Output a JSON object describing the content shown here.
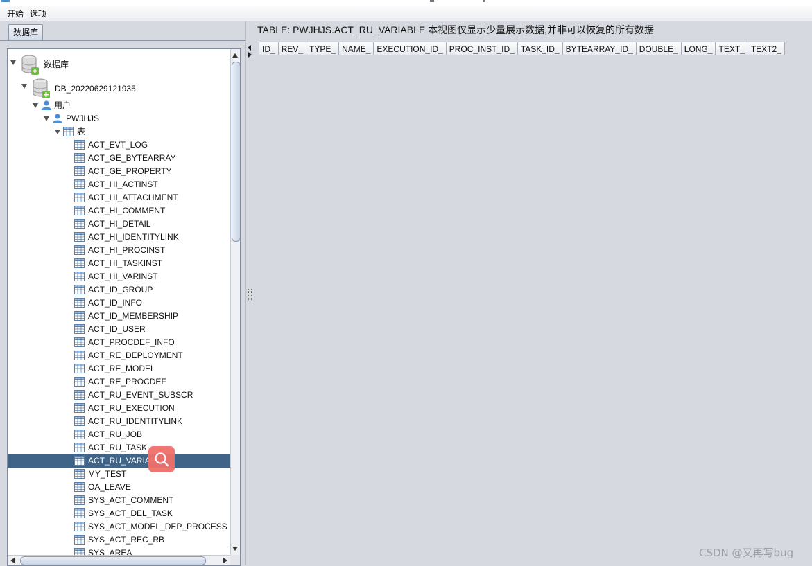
{
  "menu": [
    "开始",
    "选项"
  ],
  "left_panel": {
    "tab_label": "数据库",
    "tree": {
      "root_label": "数据库",
      "db_label": "DB_20220629121935",
      "users_label": "用户",
      "schema_label": "PWJHJS",
      "tables_label": "表",
      "tables": [
        "ACT_EVT_LOG",
        "ACT_GE_BYTEARRAY",
        "ACT_GE_PROPERTY",
        "ACT_HI_ACTINST",
        "ACT_HI_ATTACHMENT",
        "ACT_HI_COMMENT",
        "ACT_HI_DETAIL",
        "ACT_HI_IDENTITYLINK",
        "ACT_HI_PROCINST",
        "ACT_HI_TASKINST",
        "ACT_HI_VARINST",
        "ACT_ID_GROUP",
        "ACT_ID_INFO",
        "ACT_ID_MEMBERSHIP",
        "ACT_ID_USER",
        "ACT_PROCDEF_INFO",
        "ACT_RE_DEPLOYMENT",
        "ACT_RE_MODEL",
        "ACT_RE_PROCDEF",
        "ACT_RU_EVENT_SUBSCR",
        "ACT_RU_EXECUTION",
        "ACT_RU_IDENTITYLINK",
        "ACT_RU_JOB",
        "ACT_RU_TASK",
        "ACT_RU_VARIABLE",
        "MY_TEST",
        "OA_LEAVE",
        "SYS_ACT_COMMENT",
        "SYS_ACT_DEL_TASK",
        "SYS_ACT_MODEL_DEP_PROCESS",
        "SYS_ACT_REC_RB",
        "SYS_AREA"
      ],
      "selected_table": "ACT_RU_VARIABLE"
    }
  },
  "right_panel": {
    "title": "TABLE: PWJHJS.ACT_RU_VARIABLE 本视图仅显示少量展示数据,并非可以恢复的所有数据",
    "columns": [
      "ID_",
      "REV_",
      "TYPE_",
      "NAME_",
      "EXECUTION_ID_",
      "PROC_INST_ID_",
      "TASK_ID_",
      "BYTEARRAY_ID_",
      "DOUBLE_",
      "LONG_",
      "TEXT_",
      "TEXT2_"
    ]
  },
  "watermark": "CSDN @又再写bug",
  "colors": {
    "selection": "#3f6487",
    "background": "#d6d9df",
    "search_overlay": "#ef6f6a"
  },
  "icons": [
    "database-icon",
    "user-icon",
    "table-icon",
    "search-icon"
  ]
}
